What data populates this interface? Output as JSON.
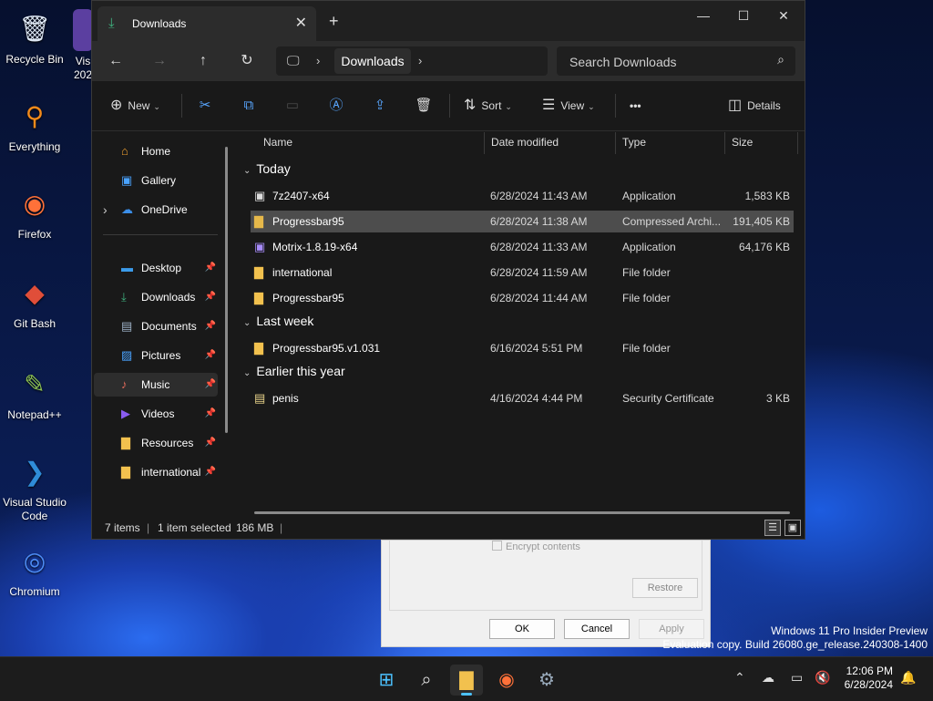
{
  "desktop": {
    "icons": [
      {
        "label": "Recycle Bin",
        "glyph": "🗑",
        "color": "#dfe8f5"
      },
      {
        "label": "Everything",
        "glyph": "⚲",
        "color": "#f28a1b"
      },
      {
        "label": "Firefox",
        "glyph": "◉",
        "color": "#ff7139"
      },
      {
        "label": "Git Bash",
        "glyph": "◆",
        "color": "#e04e39"
      },
      {
        "label": "Notepad++",
        "glyph": "✎",
        "color": "#8cc152"
      },
      {
        "label": "Visual Studio Code",
        "glyph": "❯",
        "color": "#2f8cd8"
      },
      {
        "label": "Chromium",
        "glyph": "◎",
        "color": "#4c8bf5"
      }
    ],
    "partial_icon_label": "Vis 202"
  },
  "background_dialog": {
    "encrypt_label": "Encrypt contents",
    "restore_label": "Restore",
    "ok_label": "OK",
    "cancel_label": "Cancel",
    "apply_label": "Apply"
  },
  "watermark": {
    "line1": "Windows 11 Pro Insider Preview",
    "line2": "Evaluation copy. Build 26080.ge_release.240308-1400"
  },
  "explorer": {
    "tab_title": "Downloads",
    "address": {
      "pc_glyph": "🖵",
      "segment": "Downloads"
    },
    "search_placeholder": "Search Downloads",
    "commands": {
      "new": "New",
      "sort": "Sort",
      "view": "View",
      "more": "•••",
      "details": "Details"
    },
    "sidebar": {
      "items": [
        {
          "label": "Home",
          "icon": "home-icon",
          "glyph": "⌂",
          "color": "#f0a030",
          "pinned": false
        },
        {
          "label": "Gallery",
          "icon": "gallery-icon",
          "glyph": "▣",
          "color": "#4aa3ff",
          "pinned": false
        },
        {
          "label": "OneDrive",
          "icon": "onedrive-icon",
          "glyph": "☁",
          "color": "#3b8ee8",
          "pinned": false
        }
      ],
      "quick": [
        {
          "label": "Desktop",
          "icon": "desktop-icon",
          "glyph": "▬",
          "color": "#3b9bea",
          "pinned": true
        },
        {
          "label": "Downloads",
          "icon": "downloads-icon",
          "glyph": "⤓",
          "color": "#3fb27f",
          "pinned": true
        },
        {
          "label": "Documents",
          "icon": "documents-icon",
          "glyph": "▤",
          "color": "#9fb3c8",
          "pinned": true
        },
        {
          "label": "Pictures",
          "icon": "pictures-icon",
          "glyph": "▨",
          "color": "#4aa3ff",
          "pinned": true
        },
        {
          "label": "Music",
          "icon": "music-icon",
          "glyph": "♪",
          "color": "#e06a5a",
          "pinned": true
        },
        {
          "label": "Videos",
          "icon": "videos-icon",
          "glyph": "▶",
          "color": "#8a5cf0",
          "pinned": true
        },
        {
          "label": "Resources",
          "icon": "folder-icon",
          "glyph": "▇",
          "color": "#f2c14e",
          "pinned": true
        },
        {
          "label": "international",
          "icon": "folder-icon",
          "glyph": "▇",
          "color": "#f2c14e",
          "pinned": true
        }
      ]
    },
    "columns": {
      "name": "Name",
      "date": "Date modified",
      "type": "Type",
      "size": "Size"
    },
    "groups": [
      {
        "label": "Today",
        "files": [
          {
            "name": "7z2407-x64",
            "date": "6/28/2024 11:43 AM",
            "type": "Application",
            "size": "1,583 KB",
            "icon": "app-icon",
            "glyph": "▣",
            "color": "#dddddd"
          },
          {
            "name": "Progressbar95",
            "date": "6/28/2024 11:38 AM",
            "type": "Compressed Archi...",
            "size": "191,405 KB",
            "icon": "zip-icon",
            "glyph": "▇",
            "color": "#e6b84a"
          },
          {
            "name": "Motrix-1.8.19-x64",
            "date": "6/28/2024 11:33 AM",
            "type": "Application",
            "size": "64,176 KB",
            "icon": "app-icon",
            "glyph": "▣",
            "color": "#a78bfa"
          },
          {
            "name": "international",
            "date": "6/28/2024 11:59 AM",
            "type": "File folder",
            "size": "",
            "icon": "folder-icon",
            "glyph": "▇",
            "color": "#f2c14e"
          },
          {
            "name": "Progressbar95",
            "date": "6/28/2024 11:44 AM",
            "type": "File folder",
            "size": "",
            "icon": "folder-icon",
            "glyph": "▇",
            "color": "#f2c14e"
          }
        ]
      },
      {
        "label": "Last week",
        "files": [
          {
            "name": "Progressbar95.v1.031",
            "date": "6/16/2024 5:51 PM",
            "type": "File folder",
            "size": "",
            "icon": "folder-icon",
            "glyph": "▇",
            "color": "#f2c14e"
          }
        ]
      },
      {
        "label": "Earlier this year",
        "files": [
          {
            "name": "penis",
            "date": "4/16/2024 4:44 PM",
            "type": "Security Certificate",
            "size": "3 KB",
            "icon": "certificate-icon",
            "glyph": "▤",
            "color": "#e8d38a"
          }
        ]
      }
    ],
    "status": {
      "count": "7 items",
      "selected": "1 item selected",
      "size": "186 MB"
    }
  },
  "taskbar": {
    "clock_time": "12:06 PM",
    "clock_date": "6/28/2024"
  },
  "colors": {
    "accent": "#4cc2ff",
    "selection": "#4d4d4d",
    "folder": "#f2c14e"
  }
}
